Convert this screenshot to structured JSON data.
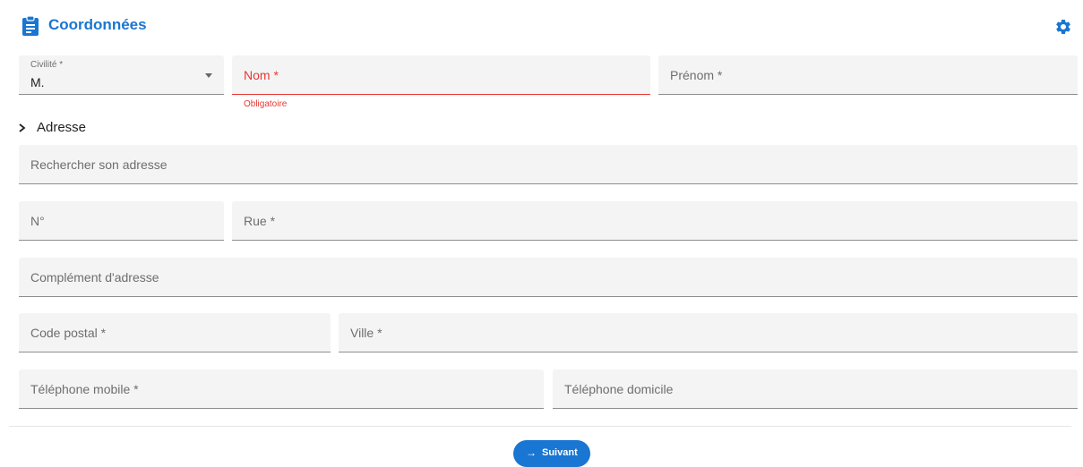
{
  "header": {
    "title": "Coordonnées",
    "icon": "clipboard-icon",
    "settings_icon": "gear-icon",
    "accent": "#1976d2"
  },
  "identity": {
    "civilite": {
      "label": "Civilité *",
      "value": "M."
    },
    "nom": {
      "placeholder": "Nom *",
      "error": "Obligatoire"
    },
    "prenom": {
      "placeholder": "Prénom *"
    }
  },
  "address": {
    "section_label": "Adresse",
    "search": {
      "placeholder": "Rechercher son adresse"
    },
    "numero": {
      "placeholder": "N°"
    },
    "rue": {
      "placeholder": "Rue *"
    },
    "complement": {
      "placeholder": "Complément d'adresse"
    },
    "code_postal": {
      "placeholder": "Code postal *"
    },
    "ville": {
      "placeholder": "Ville *"
    }
  },
  "phones": {
    "mobile": {
      "placeholder": "Téléphone mobile *"
    },
    "domicile": {
      "placeholder": "Téléphone domicile"
    }
  },
  "footer": {
    "next_label": "Suivant",
    "error_color": "#e53935"
  }
}
